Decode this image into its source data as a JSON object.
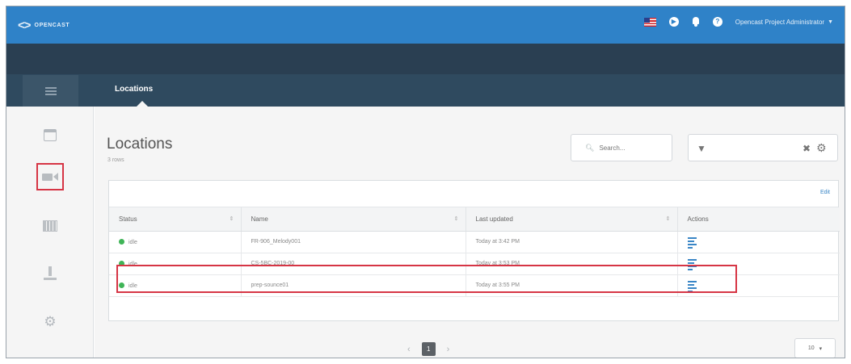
{
  "app": {
    "logo_text": "OPENCAST",
    "user_name": "Opencast Project Administrator"
  },
  "nav": {
    "active_tab": "Locations"
  },
  "sidebar": {
    "items": [
      "calendar-icon",
      "capture-agent-icon",
      "recordings-icon",
      "ingest-icon",
      "settings-gear-icon"
    ],
    "active": "capture-agent-icon"
  },
  "page": {
    "title": "Locations",
    "subtitle": "3 rows",
    "search_placeholder": "Search..."
  },
  "table": {
    "edit_label": "Edit",
    "columns": [
      "Status",
      "Name",
      "Last updated",
      "Actions"
    ],
    "rows": [
      {
        "status": "idle",
        "name": "FR-906_Melody001",
        "updated": "Today at 3:42 PM"
      },
      {
        "status": "idle",
        "name": "CS-5BC-2019-00",
        "updated": "Today at 3:53 PM"
      },
      {
        "status": "idle",
        "name": "prep-sounce01",
        "updated": "Today at 3:55 PM"
      }
    ]
  },
  "pagination": {
    "current": "1",
    "page_size": "10"
  },
  "colors": {
    "topbar": "#2f82c8",
    "nav_dark": "#2a3f52",
    "highlight": "#d63545",
    "status_ok": "#3fb457",
    "link": "#3a86c6"
  }
}
